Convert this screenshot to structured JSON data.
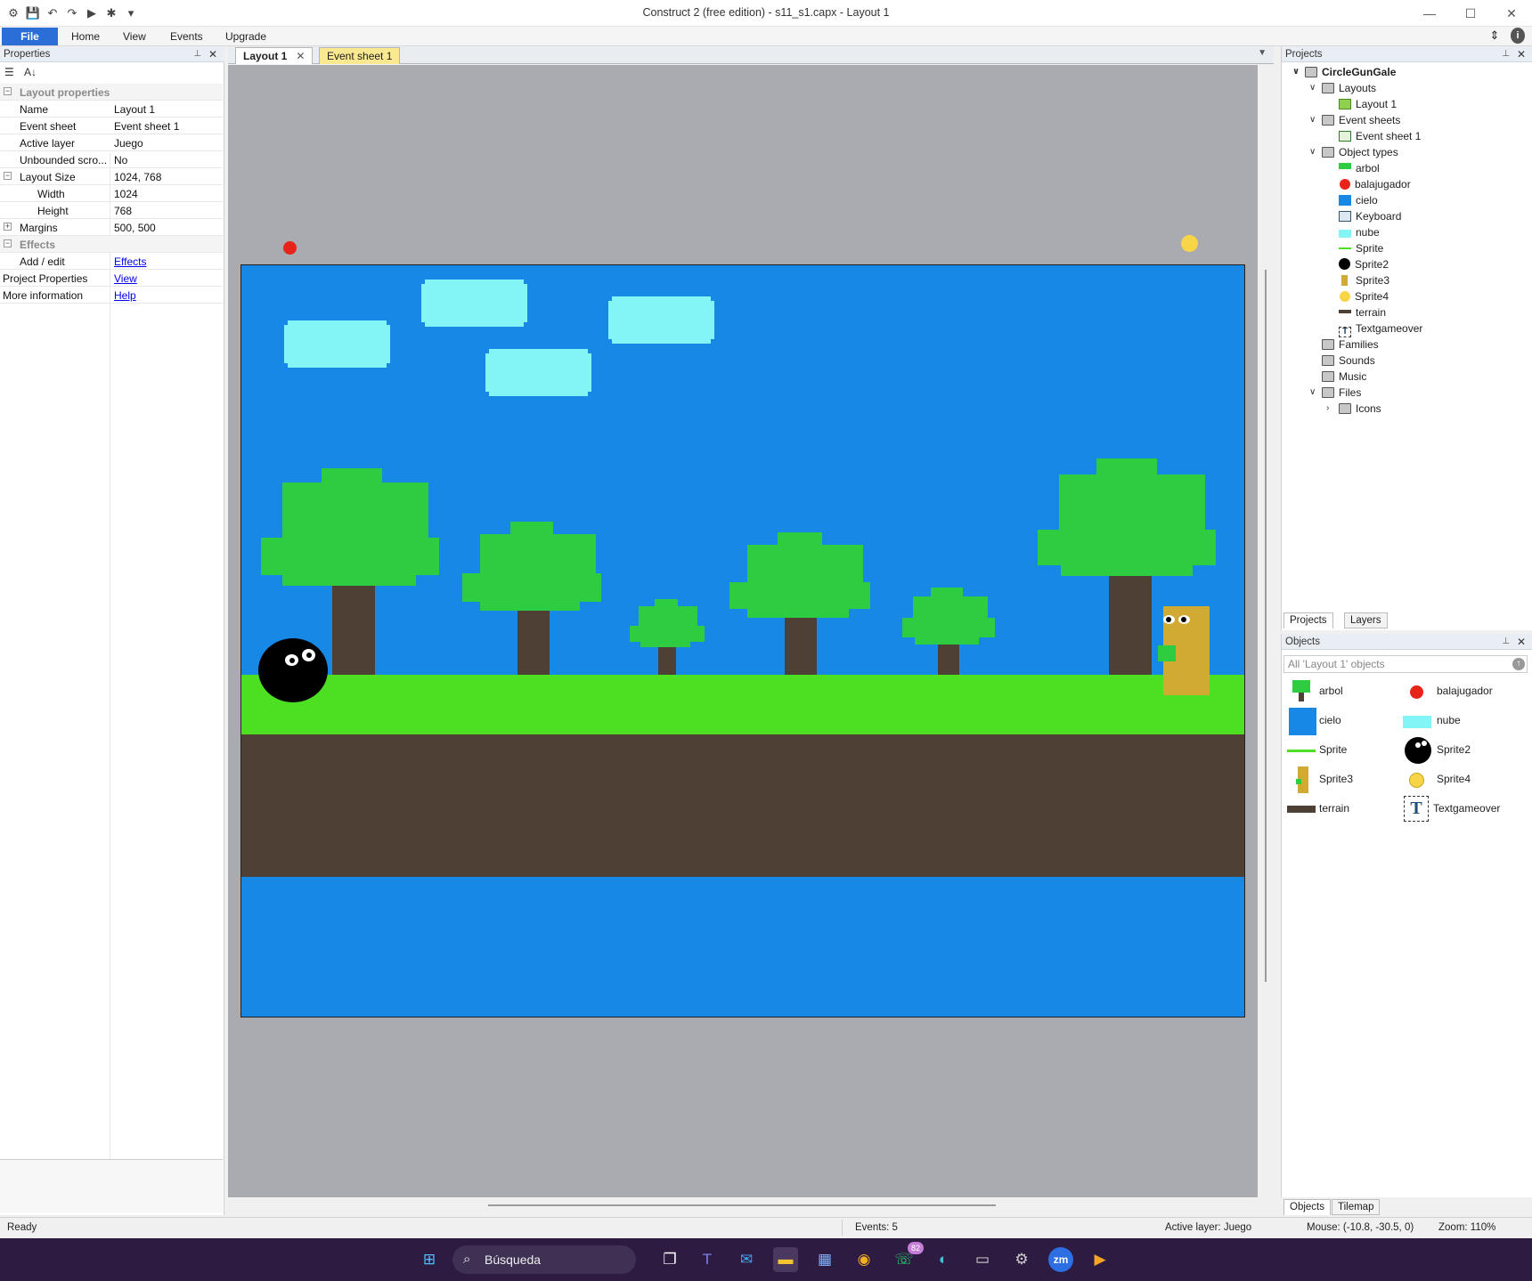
{
  "window": {
    "title": "Construct 2  (free edition) - s11_s1.capx - Layout 1",
    "controls": [
      "—",
      "☐",
      "✕"
    ]
  },
  "ribbon": {
    "tabs": [
      "File",
      "Home",
      "View",
      "Events",
      "Upgrade"
    ]
  },
  "properties": {
    "header": "Properties",
    "category_layout": "Layout properties",
    "rows": {
      "name": {
        "key": "Name",
        "value": "Layout 1"
      },
      "event_sheet": {
        "key": "Event sheet",
        "value": "Event sheet 1"
      },
      "active_layer": {
        "key": "Active layer",
        "value": "Juego"
      },
      "unbounded": {
        "key": "Unbounded scro...",
        "value": "No"
      },
      "layout_size": {
        "key": "Layout Size",
        "value": "1024, 768"
      },
      "width": {
        "key": "Width",
        "value": "1024"
      },
      "height": {
        "key": "Height",
        "value": "768"
      },
      "margins": {
        "key": "Margins",
        "value": "500, 500"
      }
    },
    "category_effects": "Effects",
    "add_edit": {
      "key": "Add / edit",
      "link": "Effects"
    },
    "project_properties": {
      "key": "Project Properties",
      "link": "View"
    },
    "more_information": {
      "key": "More information",
      "link": "Help"
    }
  },
  "doc_tabs": {
    "layout": "Layout 1",
    "event_sheet": "Event sheet 1"
  },
  "projects": {
    "header": "Projects",
    "root": "CircleGunGale",
    "layouts_folder": "Layouts",
    "layout_item": "Layout 1",
    "event_sheets_folder": "Event sheets",
    "event_sheet_item": "Event sheet 1",
    "object_types_folder": "Object types",
    "object_types": [
      "arbol",
      "balajugador",
      "cielo",
      "Keyboard",
      "nube",
      "Sprite",
      "Sprite2",
      "Sprite3",
      "Sprite4",
      "terrain",
      "Textgameover"
    ],
    "families": "Families",
    "sounds": "Sounds",
    "music": "Music",
    "files": "Files",
    "icons": "Icons",
    "tabs": [
      "Projects",
      "Layers"
    ]
  },
  "objects": {
    "header": "Objects",
    "filter": "All 'Layout 1' objects",
    "items": [
      "arbol",
      "balajugador",
      "cielo",
      "nube",
      "Sprite",
      "Sprite2",
      "Sprite3",
      "Sprite4",
      "terrain",
      "Textgameover"
    ],
    "tabs": [
      "Objects",
      "Tilemap"
    ]
  },
  "status": {
    "ready": "Ready",
    "events": "Events: 5",
    "active_layer": "Active layer: Juego",
    "mouse": "Mouse: (-10.8, -30.5, 0)",
    "zoom": "Zoom: 110%"
  },
  "taskbar": {
    "search": "Búsqueda",
    "whatsapp_badge": "82"
  },
  "colors": {
    "sky": "#1788e6",
    "grass": "#4ddf22",
    "dirt": "#4f4035",
    "cloud": "#83f5f7",
    "tree_leaves": "#2ecc40",
    "tree_trunk": "#4f4035",
    "accent": "#2b6ed8"
  }
}
